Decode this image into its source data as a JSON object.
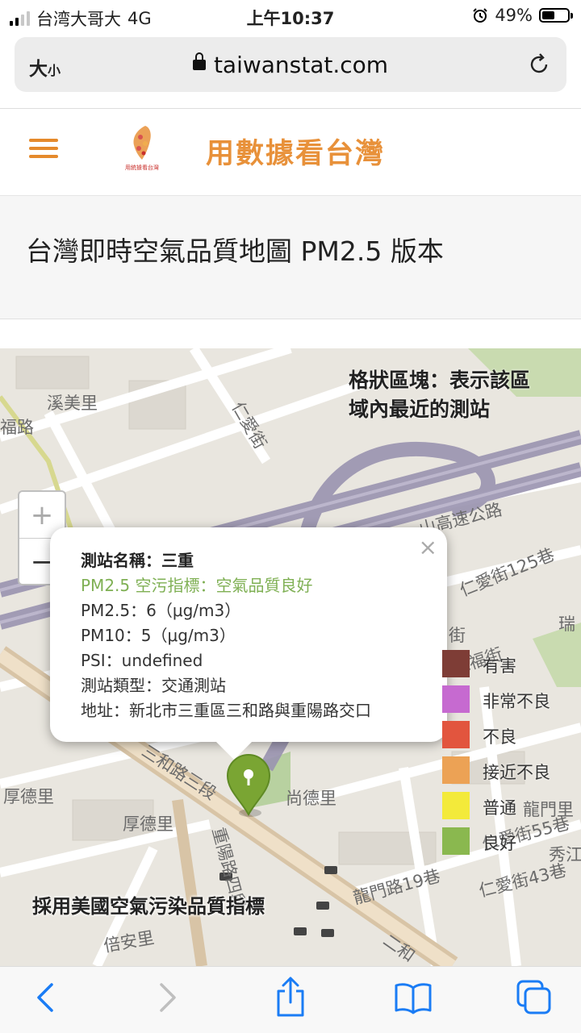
{
  "status_bar": {
    "carrier": "台湾大哥大",
    "network": "4G",
    "time": "上午10:37",
    "battery_text": "49%",
    "battery_level": 0.49
  },
  "browser": {
    "text_size_label": "大",
    "text_size_small": "小",
    "url": "taiwanstat.com"
  },
  "header": {
    "site_title": "用數據看台灣",
    "logo_text": "用統據看台灣"
  },
  "page": {
    "title": "台灣即時空氣品質地圖 PM2.5 版本"
  },
  "map": {
    "grid_note_line1": "格狀區塊：表示該區",
    "grid_note_line2": "域內最近的測站",
    "zoom_in": "+",
    "zoom_out": "−",
    "footer": "採用美國空氣污染品質指標",
    "road_labels": [
      "溪美里",
      "福路",
      "仁愛街",
      "山高速公路",
      "仁愛街125巷",
      "瑞",
      "仁福街",
      "街",
      "三和路三段",
      "厚德里",
      "尚德里",
      "重陽路四段",
      "龍門里",
      "仁愛街55巷",
      "秀江",
      "龍門路19巷",
      "仁愛街43巷",
      "厚德里",
      "倍安里",
      "二和"
    ],
    "popup": {
      "close": "×",
      "station_name": "測站名稱：三重",
      "level": "PM2.5 空污指標：空氣品質良好",
      "pm25": "PM2.5：6（μg/m3）",
      "pm10": "PM10：5（μg/m3）",
      "psi": "PSI：undefined",
      "station_type": "測站類型：交通測站",
      "address": "地址：新北市三重區三和路與重陽路交口"
    },
    "legend": [
      {
        "label": "有害",
        "color": "#7e3d36"
      },
      {
        "label": "非常不良",
        "color": "#c66ad0"
      },
      {
        "label": "不良",
        "color": "#e2553e"
      },
      {
        "label": "接近不良",
        "color": "#eca255"
      },
      {
        "label": "普通",
        "color": "#f3ea3a"
      },
      {
        "label": "良好",
        "color": "#8ab84f"
      }
    ]
  },
  "colors": {
    "accent": "#e8913a",
    "good": "#7fb054",
    "marker": "#7aa533"
  }
}
